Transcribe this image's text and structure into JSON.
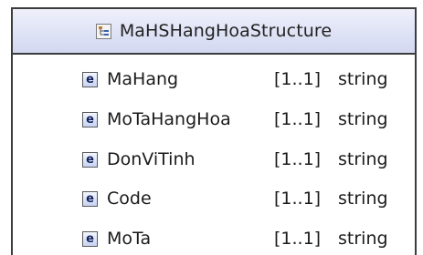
{
  "complex_type": {
    "name": "MaHSHangHoaStructure",
    "icon": "complex-type-icon"
  },
  "compositor": {
    "kind": "sequence",
    "icon": "sequence-compositor-icon"
  },
  "elements": [
    {
      "icon": "e",
      "name": "MaHang",
      "cardinality": "[1..1]",
      "type": "string"
    },
    {
      "icon": "e",
      "name": "MoTaHangHoa",
      "cardinality": "[1..1]",
      "type": "string"
    },
    {
      "icon": "e",
      "name": "DonViTinh",
      "cardinality": "[1..1]",
      "type": "string"
    },
    {
      "icon": "e",
      "name": "Code",
      "cardinality": "[1..1]",
      "type": "string"
    },
    {
      "icon": "e",
      "name": "MoTa",
      "cardinality": "[1..1]",
      "type": "string"
    }
  ]
}
